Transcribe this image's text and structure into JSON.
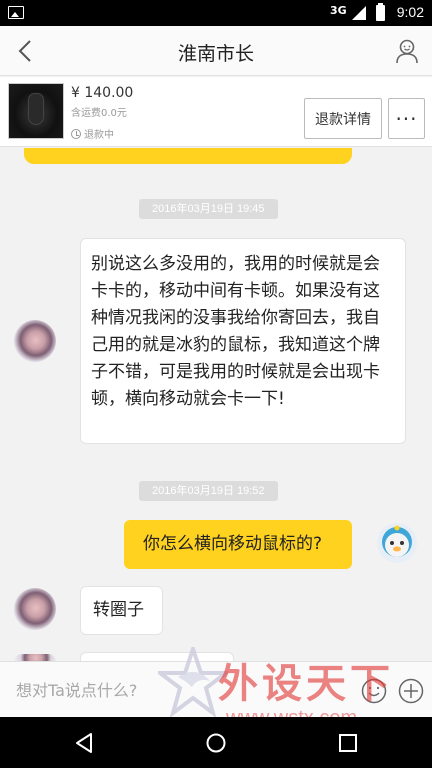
{
  "status_bar": {
    "network": "3G",
    "time": "9:02"
  },
  "header": {
    "title": "淮南市长",
    "icons": {
      "back": "back-arrow-icon",
      "profile": "profile-icon"
    }
  },
  "order": {
    "price": "¥ 140.00",
    "shipping": "含运费0.0元",
    "status": "退款中",
    "refund_button": "退款详情",
    "more_button": "···"
  },
  "messages": [
    {
      "timestamp": "2016年03月19日 19:45"
    },
    {
      "sender": "other",
      "text": "别说这么多没用的，我用的时候就是会卡卡的，移动中间有卡顿。如果没有这种情况我闲的没事我给你寄回去，我自己用的就是冰豹的鼠标，我知道这个牌子不错，可是我用的时候就是会出现卡顿，横向移动就会卡一下!"
    },
    {
      "timestamp": "2016年03月19日 19:52"
    },
    {
      "sender": "self",
      "text": "你怎么横向移动鼠标的?"
    },
    {
      "sender": "other",
      "text": "转圈子"
    }
  ],
  "input": {
    "placeholder": "想对Ta说点什么?",
    "icons": {
      "emoji": "emoji-icon",
      "add": "plus-icon"
    }
  },
  "watermark": {
    "text": "外设天下",
    "url": "www.wstx.com"
  },
  "nav_bar": {
    "icons": [
      "back-triangle-icon",
      "home-circle-icon",
      "recents-square-icon"
    ]
  },
  "colors": {
    "accent": "#ffd21f",
    "bubble_other": "#ffffff",
    "background": "#f2f2f2",
    "timestamp_bg": "#dcdcdc",
    "watermark": "#e23a3a"
  }
}
